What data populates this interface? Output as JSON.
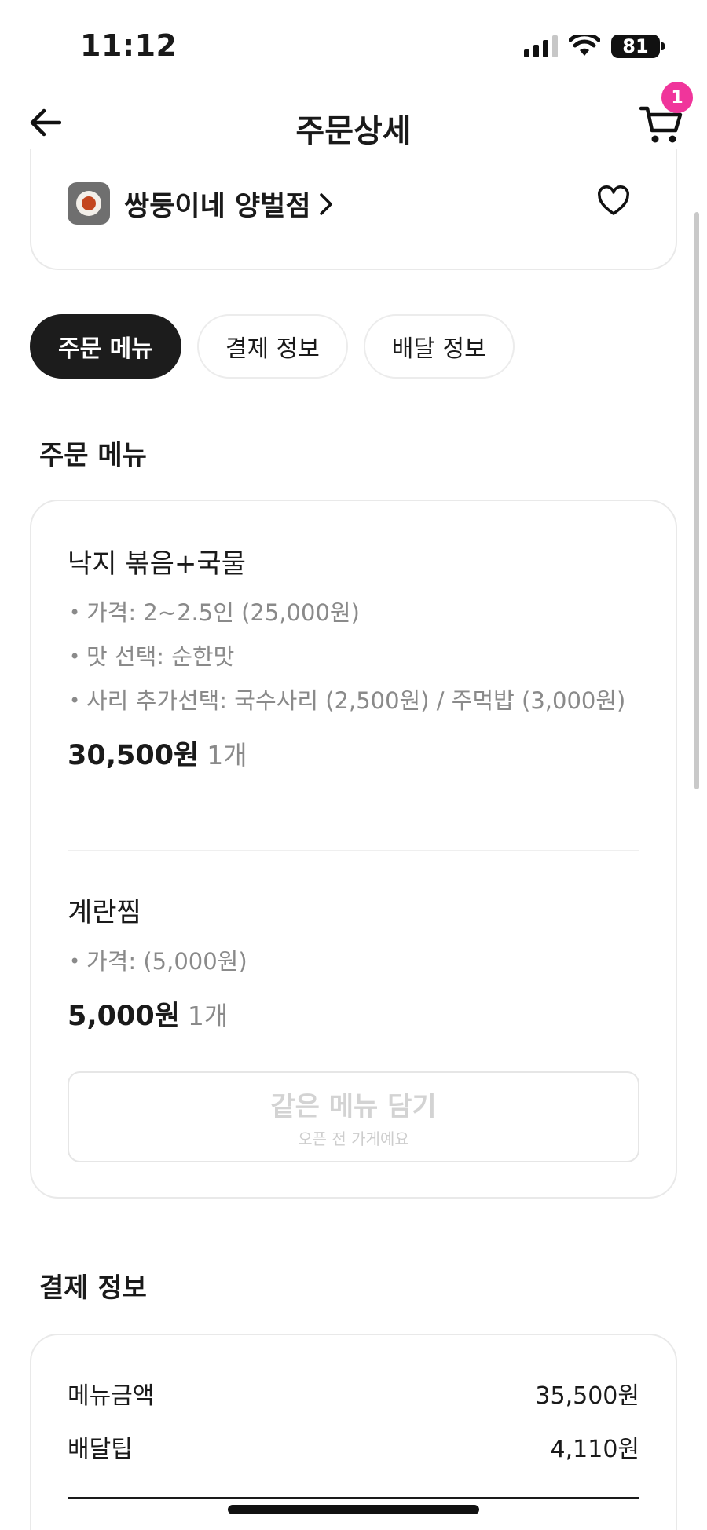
{
  "status_bar": {
    "time": "11:12",
    "battery": "81"
  },
  "nav": {
    "title": "주문상세",
    "cart_count": "1"
  },
  "store": {
    "name": "쌍둥이네 양벌점"
  },
  "tabs": [
    {
      "label": "주문 메뉴",
      "active": true
    },
    {
      "label": "결제 정보",
      "active": false
    },
    {
      "label": "배달 정보",
      "active": false
    }
  ],
  "order_menu": {
    "section_title": "주문 메뉴",
    "items": [
      {
        "name": "낙지 볶음+국물",
        "options": [
          "가격: 2~2.5인 (25,000원)",
          "맛 선택: 순한맛",
          "사리 추가선택: 국수사리 (2,500원) / 주먹밥 (3,000원)"
        ],
        "price": "30,500원",
        "quantity": "1개"
      },
      {
        "name": "계란찜",
        "options": [
          "가격: (5,000원)"
        ],
        "price": "5,000원",
        "quantity": "1개"
      }
    ],
    "reorder_button": {
      "label": "같은 메뉴 담기",
      "sublabel": "오픈 전 가게예요"
    }
  },
  "payment": {
    "section_title": "결제 정보",
    "rows": [
      {
        "label": "메뉴금액",
        "value": "35,500원"
      },
      {
        "label": "배달팁",
        "value": "4,110원"
      }
    ]
  }
}
